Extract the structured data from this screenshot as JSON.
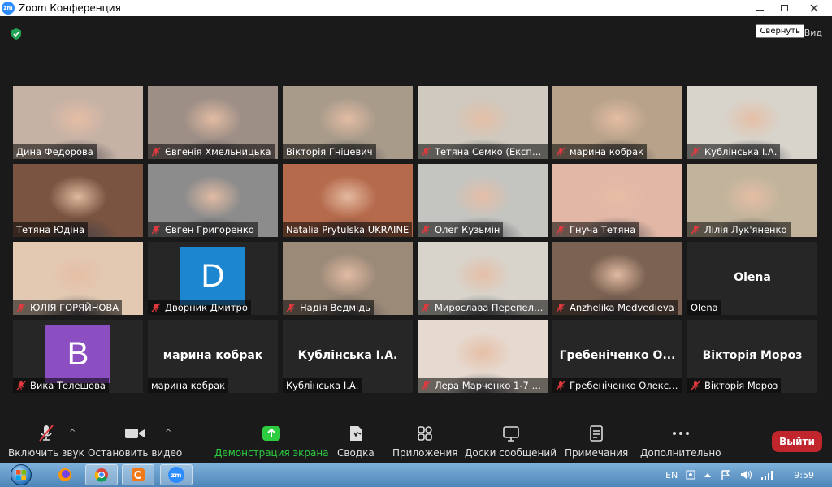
{
  "window": {
    "title": "Zoom Конференция",
    "app_icon_text": "zm",
    "tooltip": "Свернуть",
    "view_label_left": "В",
    "view_label": "Вид"
  },
  "participants": [
    {
      "name": "Дина Федорова",
      "muted": false,
      "type": "video",
      "bg": "#c6b2a5"
    },
    {
      "name": "Євгенія  Хмельницька",
      "muted": true,
      "type": "video",
      "bg": "#9e8f86"
    },
    {
      "name": "Вікторія Гніцевич",
      "muted": false,
      "type": "video",
      "bg": "#a89b8a"
    },
    {
      "name": "Тетяна Семко (Експерт)",
      "muted": true,
      "type": "video",
      "bg": "#cfc9bf"
    },
    {
      "name": "марина кобрак",
      "muted": true,
      "type": "video",
      "bg": "#b8a38a"
    },
    {
      "name": "Кублінська І.А.",
      "muted": true,
      "type": "video",
      "bg": "#d8d4cc"
    },
    {
      "name": "Тетяна Юдіна",
      "muted": false,
      "type": "video",
      "bg": "#7a5440"
    },
    {
      "name": "Євген Григоренко",
      "muted": true,
      "type": "video",
      "bg": "#8c8c8c"
    },
    {
      "name": "Natalia Prytulska UKRAINE",
      "muted": false,
      "type": "video",
      "bg": "#b56a4c",
      "active": true
    },
    {
      "name": "Олег Кузьмін",
      "muted": true,
      "type": "video",
      "bg": "#c4c4c0"
    },
    {
      "name": "Гнуча Тетяна",
      "muted": true,
      "type": "video",
      "bg": "#e2b7a6"
    },
    {
      "name": "Лілія Лук'яненко",
      "muted": true,
      "type": "video",
      "bg": "#c2b49c"
    },
    {
      "name": "ЮЛІЯ ГОРЯЙНОВА",
      "muted": true,
      "type": "video",
      "bg": "#e3c9b2"
    },
    {
      "name": "Дворник Дмитро",
      "muted": true,
      "type": "avatar",
      "letter": "D",
      "avatar_color": "#1d86d0"
    },
    {
      "name": "Надія Ведмідь",
      "muted": true,
      "type": "video",
      "bg": "#9c8a78"
    },
    {
      "name": "Мирослава Перепелиця",
      "muted": true,
      "type": "video",
      "bg": "#d8d4cc"
    },
    {
      "name": "Anzhelika Medvedieva",
      "muted": true,
      "type": "video",
      "bg": "#7b6252"
    },
    {
      "name": "Olena",
      "muted": false,
      "type": "name",
      "display": "Olena"
    },
    {
      "name": "Вика Телешова",
      "muted": true,
      "type": "avatar",
      "letter": "B",
      "avatar_color": "#8b4fc2"
    },
    {
      "name": "марина кобрак",
      "muted": false,
      "type": "name",
      "display": "марина кобрак"
    },
    {
      "name": "Кублінська І.А.",
      "muted": false,
      "type": "name",
      "display": "Кублінська І.А."
    },
    {
      "name": "Лера Марченко 1-7 (2)",
      "muted": true,
      "type": "video",
      "bg": "#e6d9cf"
    },
    {
      "name": "Гребеніченко Олександра",
      "muted": true,
      "type": "name",
      "display": "Гребеніченко  О..."
    },
    {
      "name": "Вікторія Мороз",
      "muted": true,
      "type": "name",
      "display": "Вікторія Мороз"
    }
  ],
  "toolbar": {
    "mute": "Включить звук",
    "video": "Остановить видео",
    "share": "Демонстрация экрана",
    "summary": "Сводка",
    "apps": "Приложения",
    "whiteboards": "Доски сообщений",
    "notes": "Примечания",
    "more": "Дополнительно",
    "exit": "Выйти",
    "caret": "^"
  },
  "taskbar": {
    "language": "EN",
    "time": "9:59"
  },
  "colors": {
    "accent_green": "#2ecc40",
    "exit_red": "#c0262c",
    "active_border": "#c9dc55",
    "zoom_blue": "#2d8cff"
  }
}
